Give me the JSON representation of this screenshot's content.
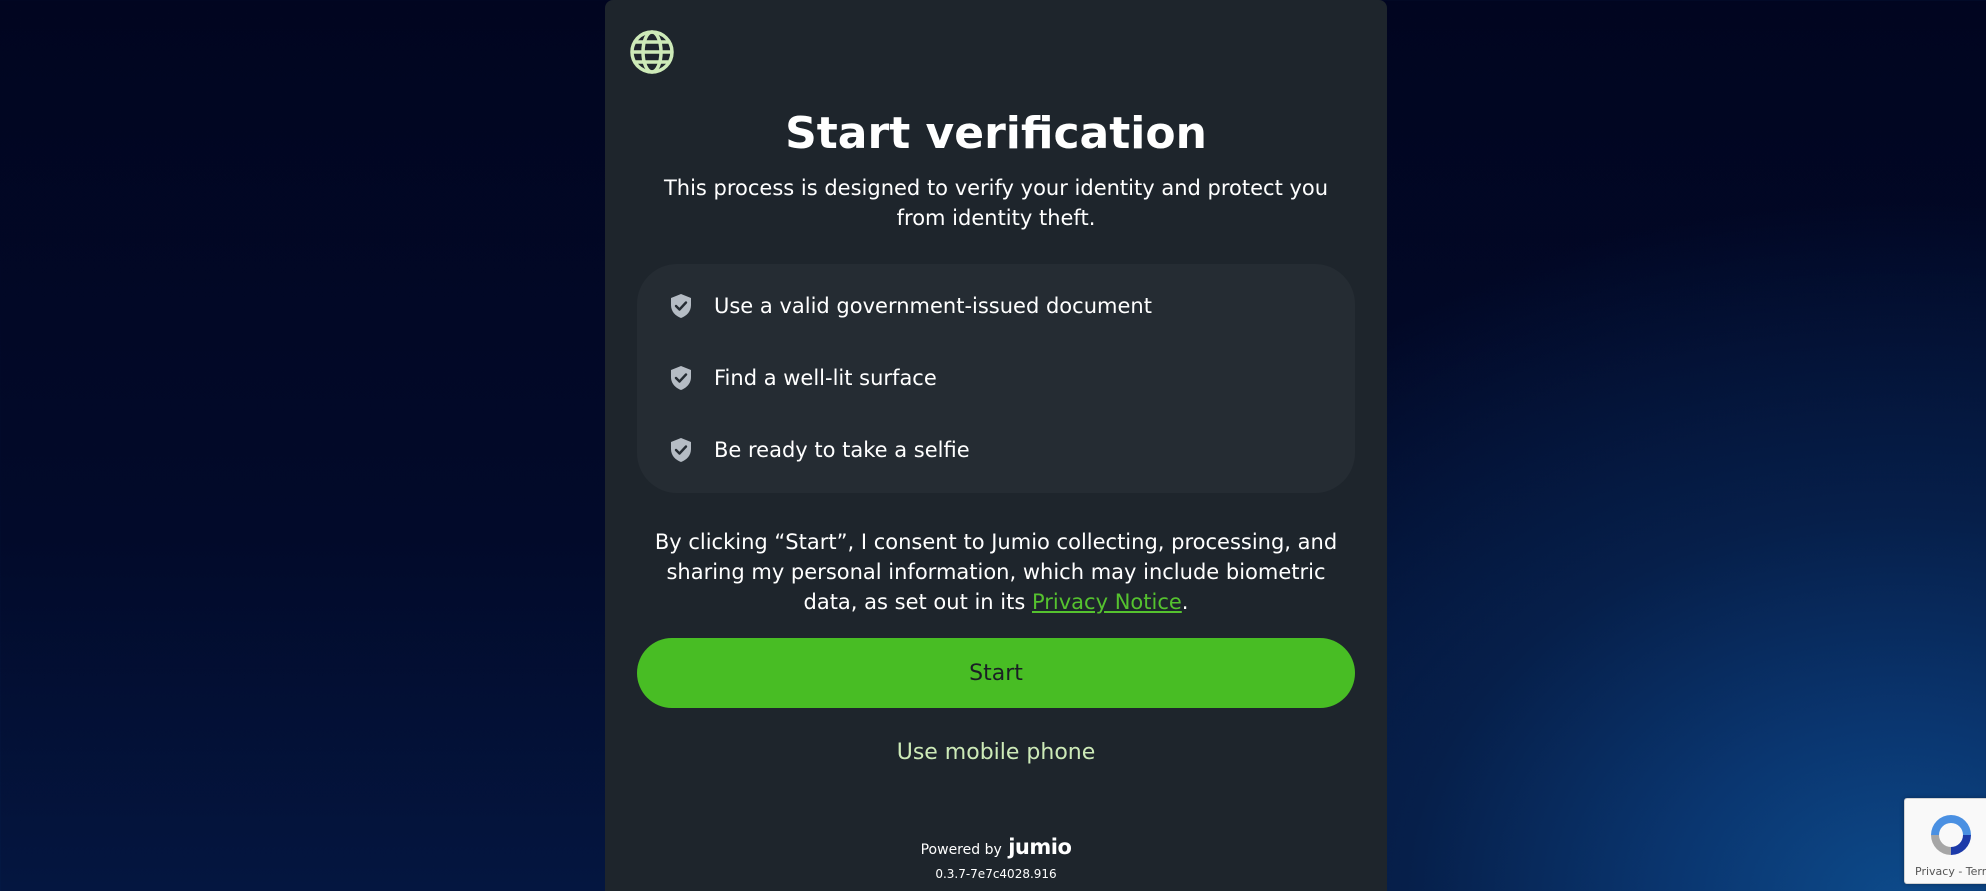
{
  "card": {
    "language_icon": "globe-icon",
    "title": "Start verification",
    "subtitle": "This process is designed to verify your identity and protect you from identity theft.",
    "checklist": [
      {
        "icon": "shield-check-icon",
        "label": "Use a valid government-issued document"
      },
      {
        "icon": "shield-check-icon",
        "label": "Find a well-lit surface"
      },
      {
        "icon": "shield-check-icon",
        "label": "Be ready to take a selfie"
      }
    ],
    "consent": {
      "prefix": "By clicking “Start”, I consent to Jumio collecting, processing, and sharing my personal information, which may include biometric data, as set out in its ",
      "link_text": "Privacy Notice",
      "suffix": "."
    },
    "start_label": "Start",
    "mobile_label": "Use mobile phone",
    "footer": {
      "powered_by": "Powered by",
      "brand": "jumio",
      "version": "0.3.7-7e7c4028.916"
    }
  },
  "recaptcha": {
    "terms": "Privacy - Terms"
  },
  "colors": {
    "accent_green": "#48bd24",
    "link_green": "#55c22f",
    "mobile_link": "#cdeab8",
    "card_bg": "#1e252c",
    "checklist_bg": "#252c33"
  }
}
